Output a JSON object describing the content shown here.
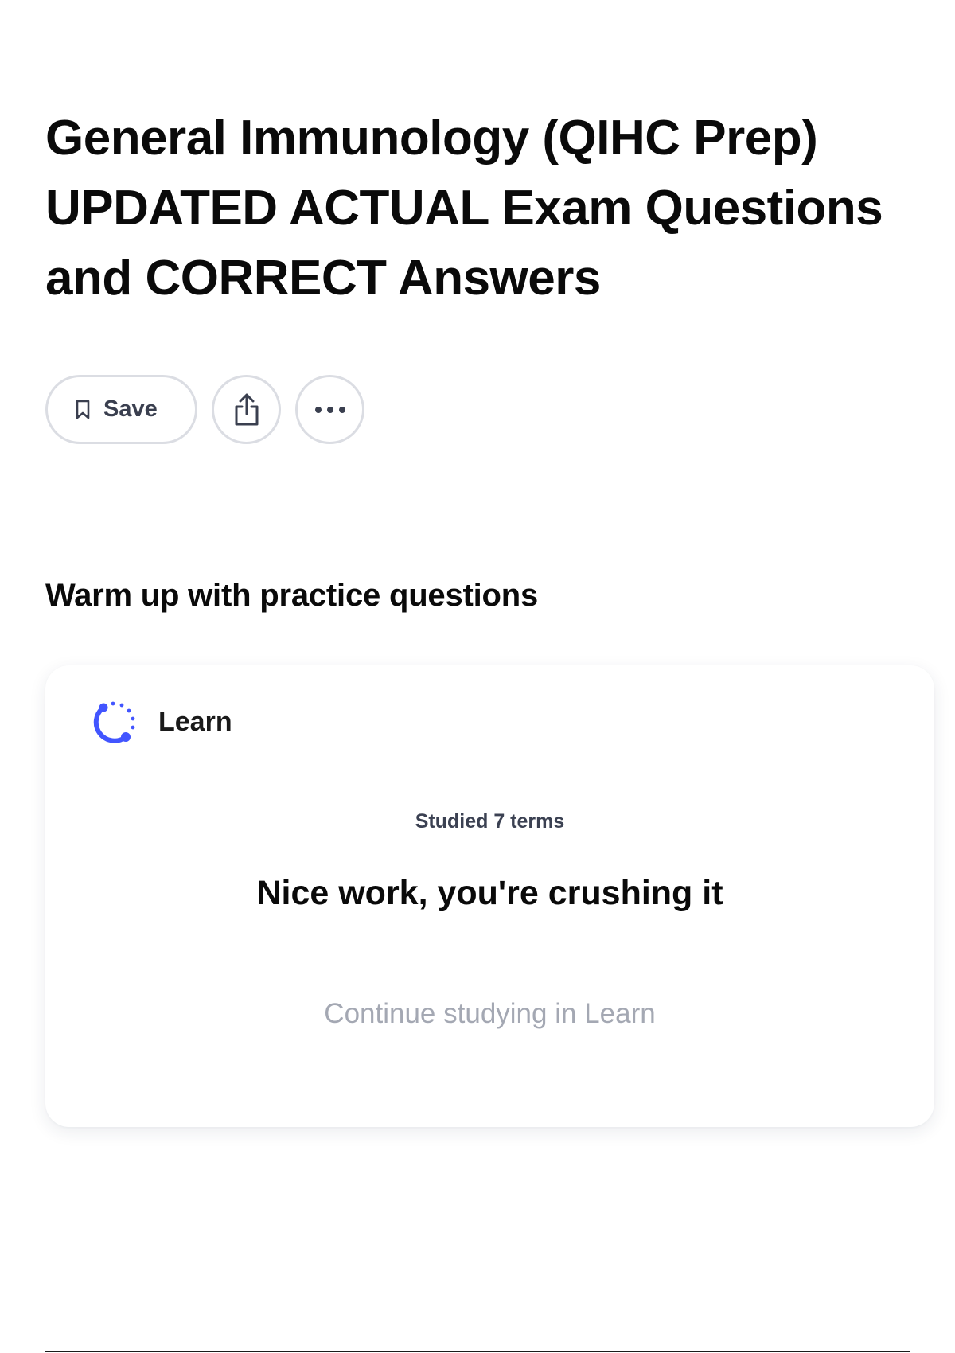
{
  "header": {
    "title": "General Immunology (QIHC Prep) UPDATED ACTUAL Exam Questions and CORRECT Answers"
  },
  "actions": {
    "save_label": "Save",
    "save_icon": "bookmark-icon",
    "share_icon": "share-icon",
    "more_icon": "more-horizontal-icon"
  },
  "practice": {
    "heading": "Warm up with practice questions",
    "card": {
      "mode_label": "Learn",
      "mode_icon": "learn-progress-icon",
      "studied_text": "Studied 7 terms",
      "praise_text": "Nice work, you're crushing it",
      "continue_label": "Continue studying in Learn"
    }
  },
  "colors": {
    "accent": "#4255ff",
    "text_primary": "#0a0a0a",
    "text_muted": "#a4a8b3",
    "border": "#dbdde3"
  }
}
